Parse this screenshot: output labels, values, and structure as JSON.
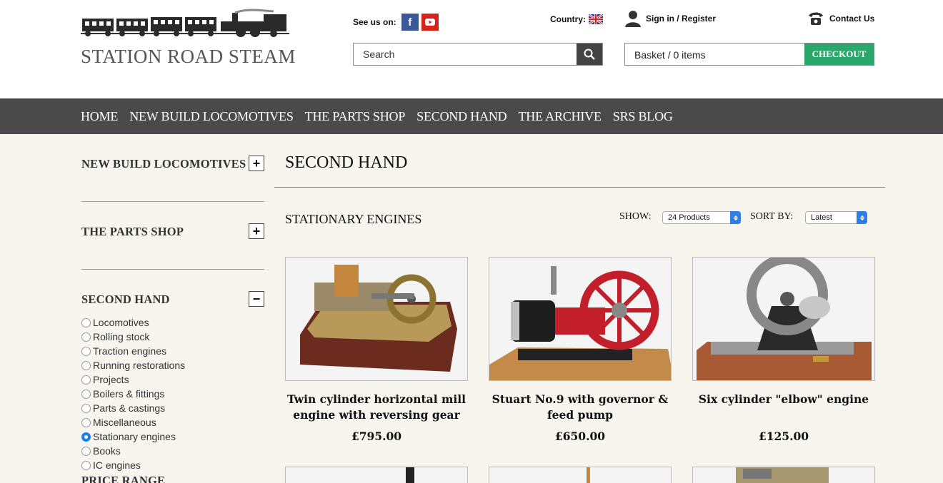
{
  "brand": {
    "name": "STATION ROAD STEAM"
  },
  "header": {
    "see_us_label": "See us on:",
    "facebook_glyph": "f",
    "country_label": "Country:",
    "signin_label": "Sign in / Register",
    "contact_label": "Contact Us",
    "search_placeholder": "Search",
    "basket_label": "Basket / 0 items",
    "checkout_label": "CHECKOUT"
  },
  "nav": {
    "items": [
      "HOME",
      "NEW BUILD LOCOMOTIVES",
      "THE PARTS SHOP",
      "SECOND HAND",
      "THE ARCHIVE",
      "SRS BLOG"
    ]
  },
  "sidebar": {
    "sections": [
      {
        "title": "NEW BUILD LOCOMOTIVES",
        "toggle": "+"
      },
      {
        "title": "THE PARTS SHOP",
        "toggle": "+"
      },
      {
        "title": "SECOND HAND",
        "toggle": "−"
      }
    ],
    "categories": [
      {
        "label": "Locomotives",
        "selected": false
      },
      {
        "label": "Rolling stock",
        "selected": false
      },
      {
        "label": "Traction engines",
        "selected": false
      },
      {
        "label": "Running restorations",
        "selected": false
      },
      {
        "label": "Projects",
        "selected": false
      },
      {
        "label": "Boilers & fittings",
        "selected": false
      },
      {
        "label": "Parts & castings",
        "selected": false
      },
      {
        "label": "Miscellaneous",
        "selected": false
      },
      {
        "label": "Stationary engines",
        "selected": true
      },
      {
        "label": "Books",
        "selected": false
      },
      {
        "label": "IC engines",
        "selected": false
      }
    ],
    "price_range_label": "PRICE RANGE"
  },
  "main": {
    "title": "SECOND HAND",
    "subtitle": "STATIONARY ENGINES",
    "show_label": "SHOW:",
    "show_value": "24 Products",
    "sort_label": "SORT BY:",
    "sort_value": "Latest"
  },
  "products": [
    {
      "name": "Twin cylinder horizontal mill engine with reversing gear",
      "price": "£795.00"
    },
    {
      "name": "Stuart No.9 with governor & feed pump",
      "price": "£650.00"
    },
    {
      "name": "Six cylinder \"elbow\" engine",
      "price": "£125.00"
    }
  ],
  "colors": {
    "nav_bg": "#4a4a4a",
    "checkout": "#2aa76b",
    "page_bg": "#f8f5ef"
  }
}
